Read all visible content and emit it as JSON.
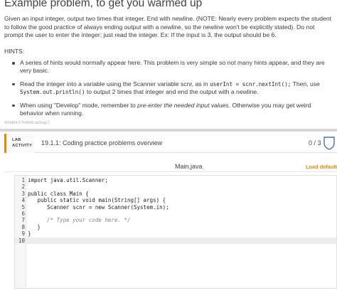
{
  "page": {
    "title": "Example problem, to get you warmed up",
    "intro": "Given an input integer, output two times that integer. End with newline. (NOTE: Nearly every problem expects the student to follow the good practice of always ending output with a newline, so the newline won't be explicitly stated). Do not prompt the user to enter the integer; just read the integer. Ex: If the input is 3, the output should be 6.",
    "hints_heading": "HINTS:",
    "hint1": "A series of hints would normally appear here. This problem is very simple so not many hints appear, and they are very basic.",
    "hint2_a": "Read the integer into a variable using the Scanner variable scnr, as in ",
    "hint2_code1": "userInt = scnr.nextInt();",
    "hint2_b": " Then, use ",
    "hint2_code2": "System.out.println()",
    "hint2_c": " to output 2 times that integer and end the output with a newline.",
    "hint3_a": "When using \"Develop\" mode, remember to ",
    "hint3_em": "pre-enter the needed input values",
    "hint3_b": ". Otherwise you may get weird behavior when running.",
    "small_id": "429484.2764948.qx3zqy7"
  },
  "lab": {
    "badge_line1": "LAB",
    "badge_line2": "ACTIVITY",
    "title": "19.1.1: Coding practice problems overview",
    "score": "0 / 3",
    "accent": "#e28b00"
  },
  "editor": {
    "file_name": "Main.java",
    "load_default": "Load default te",
    "lines": [
      {
        "n": "1",
        "parts": [
          {
            "t": "import java.util.Scanner;",
            "c": "kw-import"
          }
        ]
      },
      {
        "n": "2",
        "parts": []
      },
      {
        "n": "3",
        "parts": [
          {
            "t": "public class Main {",
            "c": ""
          }
        ]
      },
      {
        "n": "4",
        "parts": [
          {
            "t": "   public static void main(String[] args) {",
            "c": ""
          }
        ]
      },
      {
        "n": "5",
        "parts": [
          {
            "t": "      Scanner scnr = new Scanner(System.in);",
            "c": ""
          }
        ]
      },
      {
        "n": "6",
        "parts": []
      },
      {
        "n": "7",
        "parts": [
          {
            "t": "      /* Type your code here. */",
            "c": "cm"
          }
        ]
      },
      {
        "n": "8",
        "parts": [
          {
            "t": "   }",
            "c": ""
          }
        ]
      },
      {
        "n": "9",
        "parts": [
          {
            "t": "}",
            "c": ""
          }
        ]
      },
      {
        "n": "10",
        "parts": []
      }
    ]
  }
}
